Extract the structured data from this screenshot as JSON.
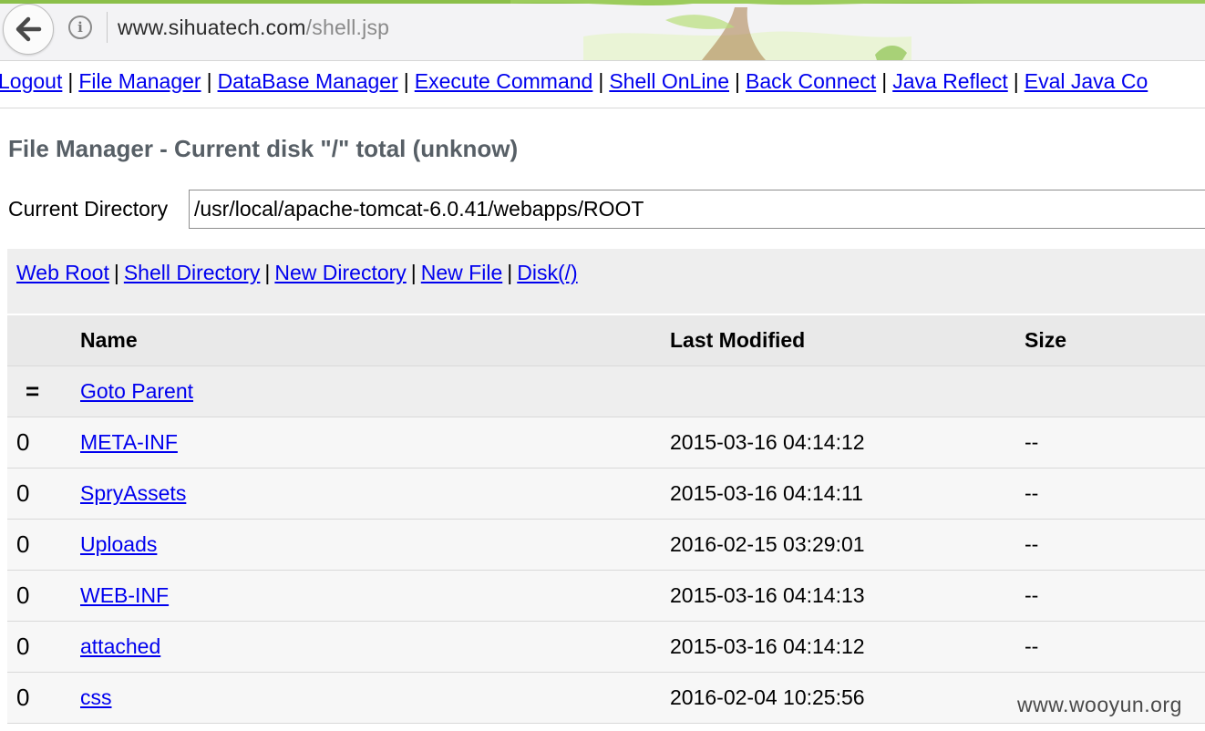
{
  "browser": {
    "url_host": "www.sihuatech.com",
    "url_path": "/shell.jsp"
  },
  "nav": {
    "items": [
      "Logout",
      "File Manager",
      "DataBase Manager",
      "Execute Command",
      "Shell OnLine",
      "Back Connect",
      "Java Reflect",
      "Eval Java Co"
    ],
    "separator": "|"
  },
  "page": {
    "title": "File Manager - Current disk \"/\" total (unknow)",
    "dir_label": "Current Directory",
    "dir_value": "/usr/local/apache-tomcat-6.0.41/webapps/ROOT"
  },
  "quick_links": [
    "Web Root",
    "Shell Directory",
    "New Directory",
    "New File",
    "Disk(/)"
  ],
  "table": {
    "headers": {
      "name": "Name",
      "modified": "Last Modified",
      "size": "Size"
    },
    "parent": {
      "mark": "=",
      "label": "Goto Parent"
    },
    "rows": [
      {
        "mark": "0",
        "name": "META-INF",
        "modified": "2015-03-16 04:14:12",
        "size": "--"
      },
      {
        "mark": "0",
        "name": "SpryAssets",
        "modified": "2015-03-16 04:14:11",
        "size": "--"
      },
      {
        "mark": "0",
        "name": "Uploads",
        "modified": "2016-02-15 03:29:01",
        "size": "--"
      },
      {
        "mark": "0",
        "name": "WEB-INF",
        "modified": "2015-03-16 04:14:13",
        "size": "--"
      },
      {
        "mark": "0",
        "name": "attached",
        "modified": "2015-03-16 04:14:12",
        "size": "--"
      },
      {
        "mark": "0",
        "name": "css",
        "modified": "2016-02-04 10:25:56",
        "size": ""
      }
    ]
  },
  "watermark": "www.wooyun.org",
  "icons": {
    "back": "back-arrow-icon",
    "info": "info-icon"
  },
  "colors": {
    "link": "#0000ee",
    "title": "#575f66",
    "panel": "#eeeeee",
    "header_row": "#e9e9e9"
  }
}
